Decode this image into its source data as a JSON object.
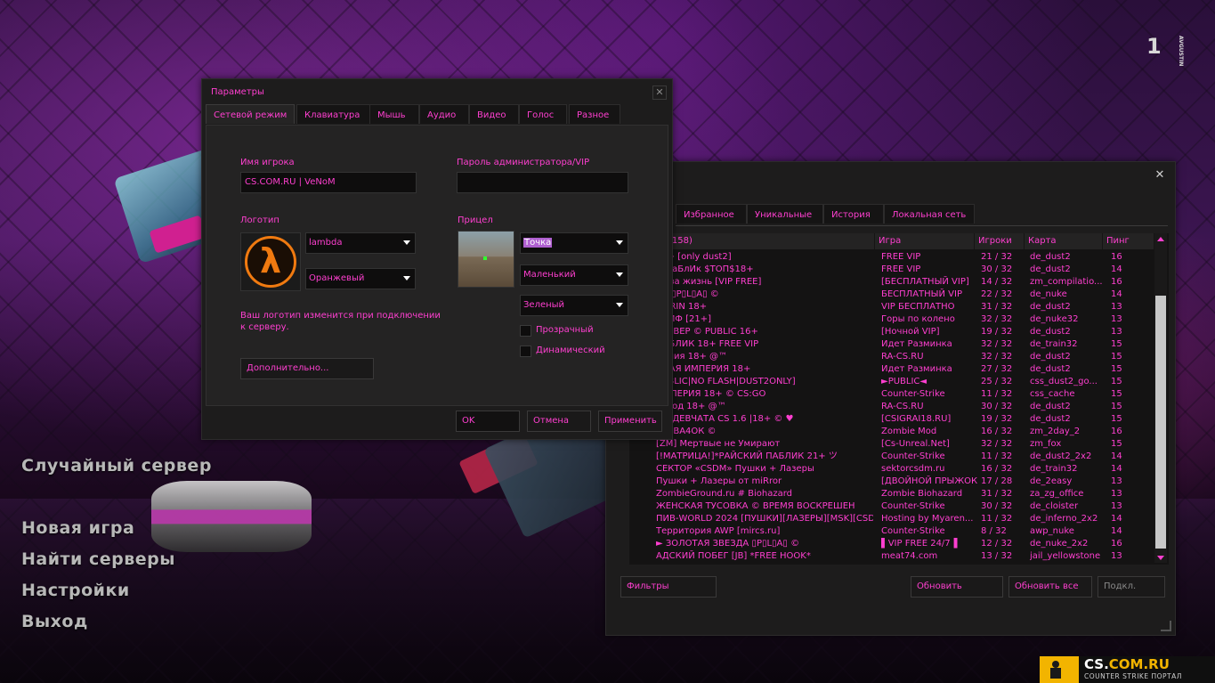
{
  "main_menu": {
    "random_server": "Случайный сервер",
    "new_game": "Новая игра",
    "find_servers": "Найти серверы",
    "settings": "Настройки",
    "exit": "Выход"
  },
  "options_dialog": {
    "title": "Параметры",
    "close": "✕",
    "tabs": [
      "Сетевой режим",
      "Клавиатура",
      "Мышь",
      "Аудио",
      "Видео",
      "Голос",
      "Разное"
    ],
    "player_name_label": "Имя игрока",
    "player_name_value": "CS.COM.RU | VeNoM",
    "admin_password_label": "Пароль администратора/VIP",
    "admin_password_value": "",
    "logo_label": "Логотип",
    "logo_value": "lambda",
    "logo_color": "Оранжевый",
    "logo_note": "Ваш логотип изменится при подключении к серверу.",
    "crosshair_label": "Прицел",
    "crosshair_style": "Точка",
    "crosshair_size": "Маленький",
    "crosshair_color": "Зеленый",
    "translucent_label": "Прозрачный",
    "dynamic_label": "Динамический",
    "advanced_button": "Дополнительно...",
    "ok_button": "OK",
    "cancel_button": "Отмена",
    "apply_button": "Применить",
    "logo_glyph": "λ"
  },
  "server_browser": {
    "close": "✕",
    "tabs": [
      "Избранное",
      "Уникальные",
      "История",
      "Локальная сеть"
    ],
    "columns": {
      "name": "(158)",
      "game": "Игра",
      "players": "Игроки",
      "map": "Карта",
      "ping": "Пинг"
    },
    "rows": [
      {
        "name": "16+ [only dust2]",
        "game": "FREE VIP",
        "players": "21 / 32",
        "map": "de_dust2",
        "ping": "16"
      },
      {
        "name": "Й ПаБлИк $ТОП$18+",
        "game": "FREE VIP",
        "players": "30 / 32",
        "map": "de_dust2",
        "ping": "14"
      },
      {
        "name": "ва за жизнь [VIP FREE]",
        "game": "[БЕСПЛАТНЫЙ VIP]",
        "players": "14 / 32",
        "map": "zm_compilatio...",
        "ping": "16"
      },
      {
        "name": "КА ▯P▯L▯A▯ ©",
        "game": "БЕСПЛАТНЫЙ VIP",
        "players": "22 / 32",
        "map": "de_nuke",
        "ping": "14"
      },
      {
        "name": "MARIN 18+",
        "game": "VIP БЕСПЛАТНО",
        "players": "31 / 32",
        "map": "de_dust2",
        "ping": "13"
      },
      {
        "name": "САЙФ [21+]",
        "game": "Горы по колено",
        "players": "32 / 32",
        "map": "de_nuke32",
        "ping": "13"
      },
      {
        "name": "СЕРВЕР © PUBLIC 16+",
        "game": "[Ночной VIP]",
        "players": "19 / 32",
        "map": "de_dust2",
        "ping": "13"
      },
      {
        "name": "ПАБЛИК 18+ FREE VIP",
        "game": "Идет Разминка",
        "players": "32 / 32",
        "map": "de_train32",
        "ping": "15"
      },
      {
        "name": "армия 18+ @™",
        "game": "RA-CS.RU",
        "players": "32 / 32",
        "map": "de_dust2",
        "ping": "15"
      },
      {
        "name": "ОВАЯ ИМПЕРИЯ 18+",
        "game": "Идет Разминка",
        "players": "27 / 32",
        "map": "de_dust2",
        "ping": "15"
      },
      {
        "name": "PUBLIC|NO FLASH|DUST2ONLY]",
        "game": "►PUBLIC◄",
        "players": "25 / 32",
        "map": "css_dust2_go...",
        "ping": "15"
      },
      {
        "name": "ИМПЕРИЯ 18+ © CS:GO",
        "game": "Counter-Strike",
        "players": "11 / 32",
        "map": "css_cache",
        "ping": "15"
      },
      {
        "name": "Взвод 18+ @™",
        "game": "RA-CS.RU",
        "players": "30 / 32",
        "map": "de_dust2",
        "ping": "15"
      },
      {
        "name": "ЫЕ ДЕВЧАТА CS 1.6 |18+ © ♥",
        "game": "[CSIGRAI18.RU]",
        "players": "19 / 32",
        "map": "de_dust2",
        "ping": "15"
      },
      {
        "name": "СЕРВА4ОК ©",
        "game": "Zombie Mod",
        "players": "16 / 32",
        "map": "zm_2day_2",
        "ping": "16"
      },
      {
        "name": "[ZM] Мертвые не Умирают",
        "game": "[Cs-Unreal.Net]",
        "players": "32 / 32",
        "map": "zm_fox",
        "ping": "15"
      },
      {
        "name": "[!МАТРИЦА!]*РАЙСКИЙ ПАБЛИК 21+ ツ",
        "game": "Counter-Strike",
        "players": "11 / 32",
        "map": "de_dust2_2x2",
        "ping": "14"
      },
      {
        "name": "СЕКТОР «CSDM» Пушки + Лазеры",
        "game": "sektorcsdm.ru",
        "players": "16 / 32",
        "map": "de_train32",
        "ping": "14"
      },
      {
        "name": "Пушки + Лазеры от miRror",
        "game": "[ДВОЙНОЙ ПРЫЖОК]",
        "players": "17 / 28",
        "map": "de_2easy",
        "ping": "13"
      },
      {
        "name": "ZombieGround.ru # Biohazard",
        "game": "Zombie Biohazard",
        "players": "31 / 32",
        "map": "za_zg_office",
        "ping": "13"
      },
      {
        "name": "ЖЕНСКАЯ ТУСОВКА © ВРЕМЯ ВОСКРЕШЕН",
        "game": "Counter-Strike",
        "players": "30 / 32",
        "map": "de_cloister",
        "ping": "13"
      },
      {
        "name": "ПИВ-WORLD 2024 [ПУШКИ][ЛАЗЕРЫ][MSK][CSDM]",
        "game": "Hosting by Myaren...",
        "players": "11 / 32",
        "map": "de_inferno_2x2",
        "ping": "14"
      },
      {
        "name": "Территория AWP [mircs.ru]",
        "game": "Counter-Strike",
        "players": "8 / 32",
        "map": "awp_nuke",
        "ping": "14"
      },
      {
        "name": "► ЗОЛОТАЯ ЗВЕЗДА ▯P▯L▯A▯ ©",
        "game": "▌VIP FREE 24/7▐",
        "players": "12 / 32",
        "map": "de_nuke_2x2",
        "ping": "16"
      },
      {
        "name": "АДСКИЙ ПОБЕГ [JB] *FREE HOOK*",
        "game": "meat74.com",
        "players": "13 / 32",
        "map": "jail_yellowstone",
        "ping": "13"
      }
    ],
    "filters_button": "Фильтры",
    "refresh_button": "Обновить",
    "refresh_all_button": "Обновить все",
    "connect_button": "Подкл."
  },
  "corner_logo": {
    "mark": "1",
    "sub": "AVGUSTIN"
  },
  "bottom_logo": {
    "site_prefix": "CS.",
    "site_main": "COM.RU",
    "tagline": "COUNTER STRIKE ПОРТАЛ"
  },
  "colors": {
    "accent": "#ff3fd0",
    "panel": "#1d1c1c",
    "brand_yellow": "#f2b400"
  }
}
